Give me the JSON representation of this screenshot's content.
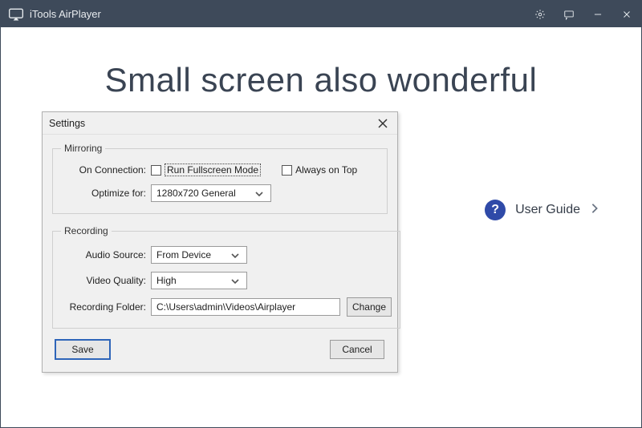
{
  "titlebar": {
    "app_title": "iTools AirPlayer"
  },
  "hero": {
    "headline": "Small screen also wonderful"
  },
  "userguide": {
    "label": "User Guide"
  },
  "settings": {
    "title": "Settings",
    "mirroring": {
      "legend": "Mirroring",
      "on_connection_label": "On Connection:",
      "run_fullscreen_label": "Run Fullscreen Mode",
      "always_on_top_label": "Always on Top",
      "optimize_for_label": "Optimize for:",
      "optimize_for_value": "1280x720 General"
    },
    "recording": {
      "legend": "Recording",
      "audio_source_label": "Audio Source:",
      "audio_source_value": "From Device",
      "video_quality_label": "Video Quality:",
      "video_quality_value": "High",
      "recording_folder_label": "Recording Folder:",
      "recording_folder_value": "C:\\Users\\admin\\Videos\\Airplayer",
      "change_label": "Change"
    },
    "save_label": "Save",
    "cancel_label": "Cancel"
  }
}
